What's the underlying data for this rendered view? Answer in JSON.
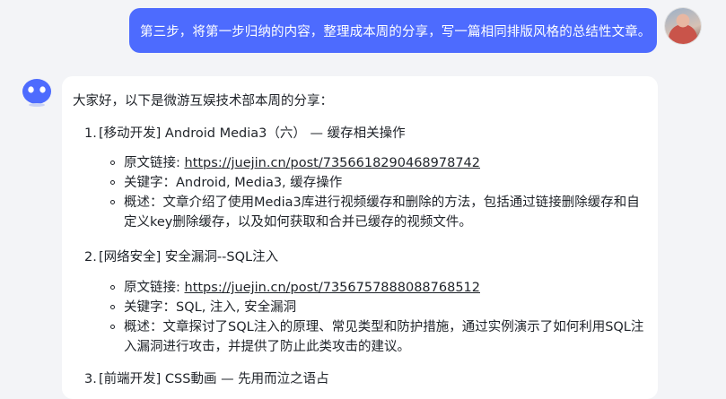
{
  "user_message": {
    "text": "第三步，将第一步归纳的内容，整理成本周的分享，写一篇相同排版风格的总结性文章。",
    "avatar_icon": "user-photo-avatar"
  },
  "assistant_message": {
    "avatar_icon": "robot-face-avatar",
    "intro": "大家好，以下是微游互娱技术部本周的分享：",
    "items": [
      {
        "num": "1.",
        "title": "[移动开发] Android Media3（六） — 缓存相关操作",
        "link_label": "原文链接: ",
        "link": "https://juejin.cn/post/7356618290468978742",
        "keywords": "关键字：Android, Media3, 缓存操作",
        "summary": "概述：文章介绍了使用Media3库进行视频缓存和删除的方法，包括通过链接删除缓存和自定义key删除缓存，以及如何获取和合并已缓存的视频文件。"
      },
      {
        "num": "2.",
        "title": "[网络安全] 安全漏洞--SQL注入",
        "link_label": "原文链接: ",
        "link": "https://juejin.cn/post/7356757888088768512",
        "keywords": "关键字：SQL, 注入, 安全漏洞",
        "summary": "概述：文章探讨了SQL注入的原理、常见类型和防护措施，通过实例演示了如何利用SQL注入漏洞进行攻击，并提供了防止此类攻击的建议。"
      },
      {
        "num": "3.",
        "title": "[前端开发] CSS動画 — 先用而泣之语占"
      }
    ]
  },
  "colors": {
    "page_bg": "#f3f4f7",
    "user_bubble": "#4d6bfe",
    "bot_avatar": "#4d6bfe",
    "text": "#1f2329"
  }
}
